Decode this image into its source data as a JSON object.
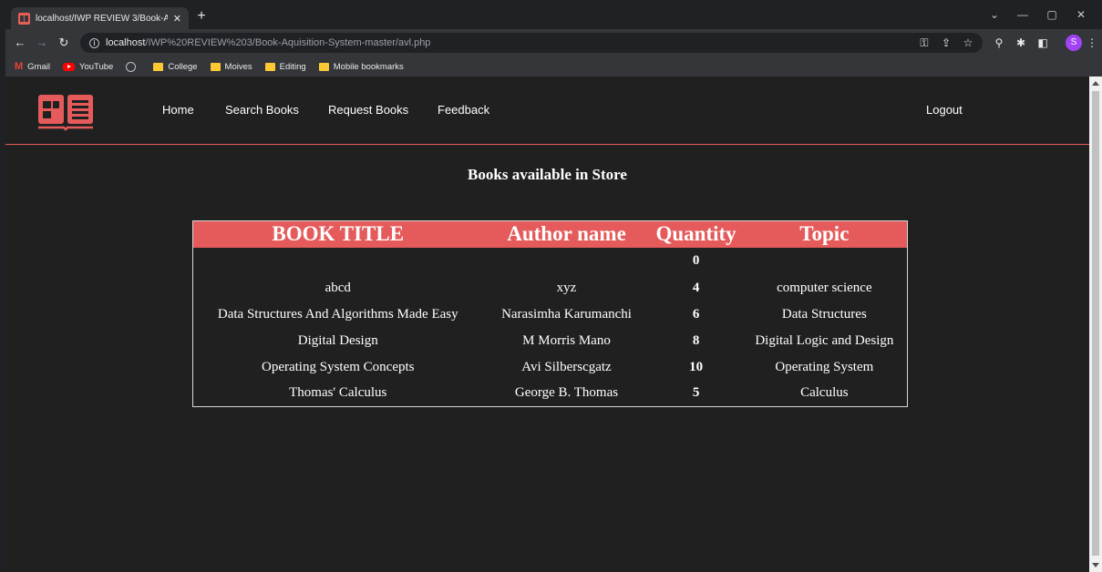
{
  "browser": {
    "tab_title": "localhost/IWP REVIEW 3/Book-A",
    "url_host": "localhost",
    "url_path": "/IWP%20REVIEW%203/Book-Aquisition-System-master/avl.php",
    "bookmarks": [
      {
        "label": "Gmail",
        "icon": "gmail-icon"
      },
      {
        "label": "YouTube",
        "icon": "youtube-icon"
      },
      {
        "label": "",
        "icon": "globe-icon"
      },
      {
        "label": "College",
        "icon": "folder-icon"
      },
      {
        "label": "Moives",
        "icon": "folder-icon"
      },
      {
        "label": "Editing",
        "icon": "folder-icon"
      },
      {
        "label": "Mobile bookmarks",
        "icon": "folder-icon"
      }
    ],
    "profile_initial": "S"
  },
  "nav": {
    "home": "Home",
    "search": "Search Books",
    "request": "Request Books",
    "feedback": "Feedback",
    "logout": "Logout"
  },
  "heading": "Books available in Store",
  "table": {
    "headers": [
      "BOOK TITLE",
      "Author name",
      "Quantity",
      "Topic"
    ],
    "rows": [
      [
        "",
        "",
        "0",
        ""
      ],
      [
        "abcd",
        "xyz",
        "4",
        "computer science"
      ],
      [
        "Data Structures And Algorithms Made Easy",
        "Narasimha Karumanchi",
        "6",
        "Data Structures"
      ],
      [
        "Digital Design",
        "M Morris Mano",
        "8",
        "Digital Logic and Design"
      ],
      [
        "Operating System Concepts",
        "Avi Silberscgatz",
        "10",
        "Operating System"
      ],
      [
        "Thomas' Calculus",
        "George B. Thomas",
        "5",
        "Calculus"
      ]
    ]
  },
  "colors": {
    "accent": "#e55b5b",
    "page_bg": "#202020"
  }
}
